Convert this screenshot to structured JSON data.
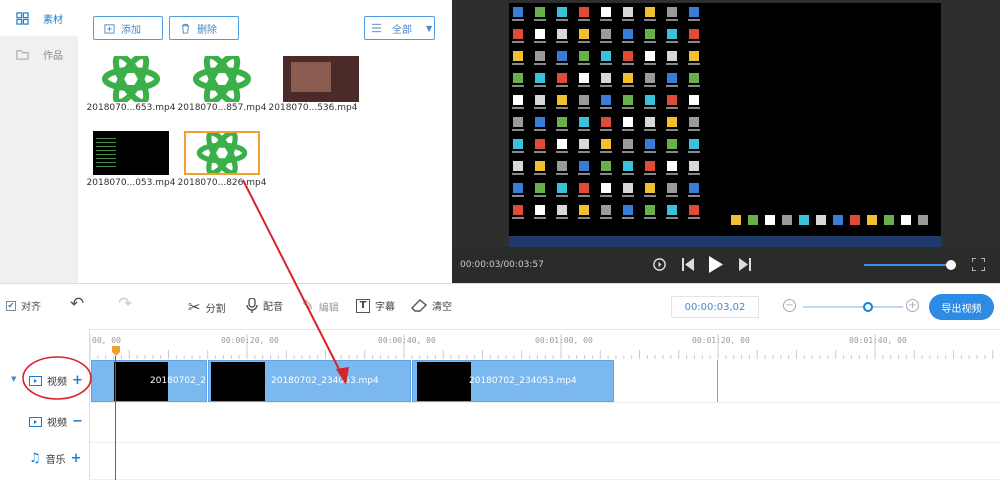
{
  "sidebar": {
    "items": [
      {
        "label": "素材",
        "icon": "grid-icon"
      },
      {
        "label": "作品",
        "icon": "folder-icon"
      }
    ]
  },
  "library": {
    "add_label": "添加",
    "delete_label": "删除",
    "filter_label": "全部",
    "files": [
      {
        "name": "2018070...653.mp4"
      },
      {
        "name": "2018070...857.mp4"
      },
      {
        "name": "2018070...536.mp4"
      },
      {
        "name": "2018070...053.mp4"
      },
      {
        "name": "2018070...826.mp4"
      }
    ]
  },
  "preview": {
    "time": "00:00:03/00:03:57",
    "volume_fraction": 0.95
  },
  "toolbar": {
    "align_label": "对齐",
    "split_label": "分割",
    "voice_label": "配音",
    "edit_label": "编辑",
    "subtitle_label": "字幕",
    "clear_label": "清空",
    "current_time": "00:00:03,02",
    "zoom_fraction": 0.65,
    "export_label": "导出视频"
  },
  "timeline": {
    "ticks": [
      "00, 00",
      "00:00:20, 00",
      "00:00:40, 00",
      "00:01:00, 00",
      "00:01:20, 00",
      "00:01:40, 00"
    ],
    "tracks": [
      {
        "label": "视频",
        "action": "+"
      },
      {
        "label": "视频",
        "action": "−"
      },
      {
        "label": "音乐",
        "action": "+"
      }
    ],
    "clips": [
      {
        "label": "20180702_2"
      },
      {
        "label": "20180702_234053.mp4"
      },
      {
        "label": "20180702_234053.mp4"
      }
    ]
  },
  "colors": {
    "accent": "#1a7fd4",
    "annotation": "#d9232a",
    "clip": "#7ab8ef"
  }
}
